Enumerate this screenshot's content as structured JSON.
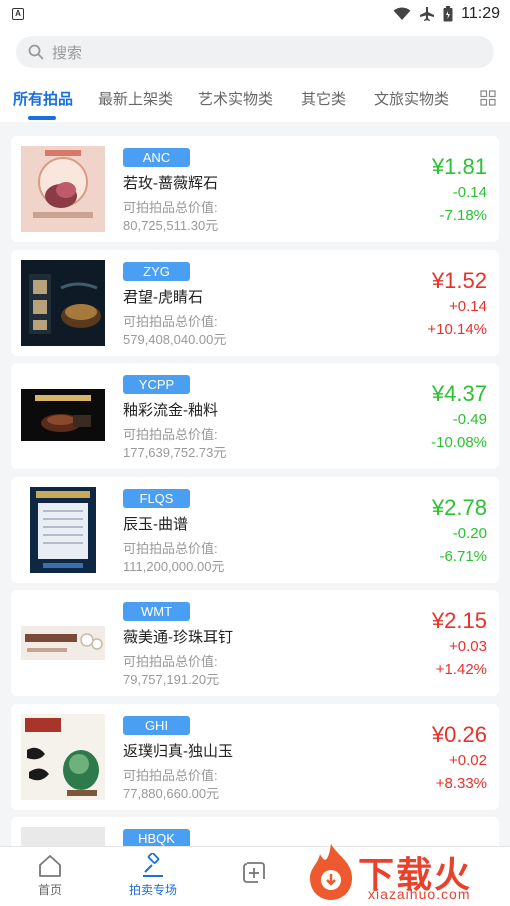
{
  "status_bar": {
    "app_icon_letter": "A",
    "time": "11:29"
  },
  "search": {
    "placeholder": "搜索"
  },
  "tabs": [
    {
      "label": "所有拍品",
      "active": true
    },
    {
      "label": "最新上架类",
      "active": false
    },
    {
      "label": "艺术实物类",
      "active": false
    },
    {
      "label": "其它类",
      "active": false
    },
    {
      "label": "文旅实物类",
      "active": false
    }
  ],
  "currency_symbol": "¥",
  "total_label": "可拍拍品总价值:",
  "colors": {
    "accent": "#1a6fe0",
    "badge": "#4b9ff2",
    "up": "#e8312a",
    "down": "#2ac231"
  },
  "items": [
    {
      "code": "ANC",
      "name": "若玫-蔷薇辉石",
      "total_value": "80,725,511.30元",
      "price": "1.81",
      "change": "-0.14",
      "pct": "-7.18%",
      "trend": "down"
    },
    {
      "code": "ZYG",
      "name": "君望-虎睛石",
      "total_value": "579,408,040.00元",
      "price": "1.52",
      "change": "+0.14",
      "pct": "+10.14%",
      "trend": "up"
    },
    {
      "code": "YCPP",
      "name": "釉彩流金-釉料",
      "total_value": "177,639,752.73元",
      "price": "4.37",
      "change": "-0.49",
      "pct": "-10.08%",
      "trend": "down"
    },
    {
      "code": "FLQS",
      "name": "辰玉-曲谱",
      "total_value": "111,200,000.00元",
      "price": "2.78",
      "change": "-0.20",
      "pct": "-6.71%",
      "trend": "down"
    },
    {
      "code": "WMT",
      "name": "薇美通-珍珠耳钉",
      "total_value": "79,757,191.20元",
      "price": "2.15",
      "change": "+0.03",
      "pct": "+1.42%",
      "trend": "up"
    },
    {
      "code": "GHI",
      "name": "返璞归真-独山玉",
      "total_value": "77,880,660.00元",
      "price": "0.26",
      "change": "+0.02",
      "pct": "+8.33%",
      "trend": "up"
    },
    {
      "code": "HBQK",
      "name": "",
      "total_value": "",
      "price": "",
      "change": "",
      "pct": "",
      "trend": "up"
    }
  ],
  "bottom_nav": [
    {
      "label": "首页",
      "icon": "home-icon",
      "active": false
    },
    {
      "label": "拍卖专场",
      "icon": "gavel-icon",
      "active": true
    },
    {
      "label": "",
      "icon": "add-square-icon",
      "active": false
    }
  ],
  "watermark": {
    "text": "下载火",
    "sub": "xiazaihuo.com"
  }
}
